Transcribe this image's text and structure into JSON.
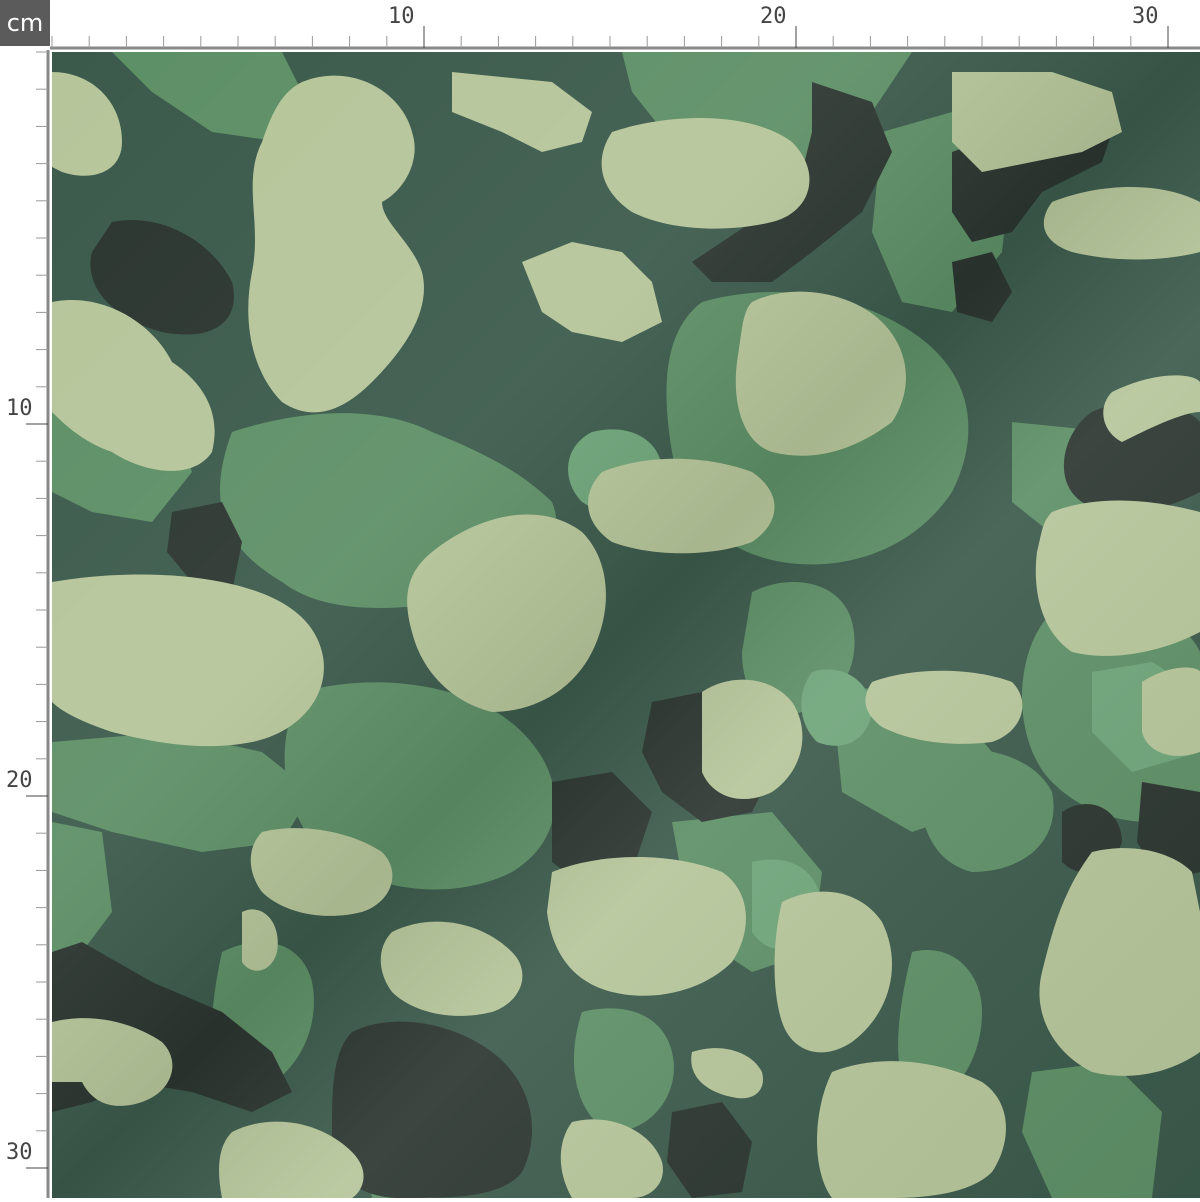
{
  "ruler": {
    "unit": "cm",
    "top_labels": [
      "10",
      "20",
      "30"
    ],
    "left_labels": [
      "10",
      "20",
      "30"
    ]
  },
  "swatch": {
    "pattern": "woodland camouflage",
    "colors": {
      "base_dark_green": "#3b5a4b",
      "mid_green": "#5d8f66",
      "light_green": "#6fa57a",
      "pale_sage": "#b6c59a",
      "near_black": "#2b352f"
    }
  }
}
